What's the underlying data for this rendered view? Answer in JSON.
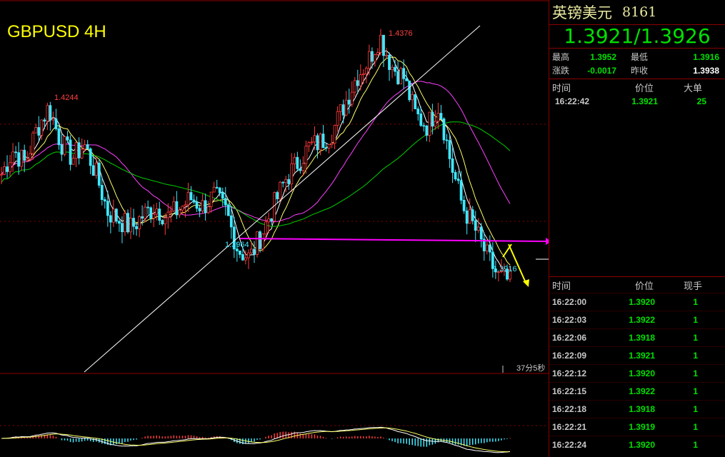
{
  "chart": {
    "symbol_label": "GBPUSD 4H",
    "countdown": "37分5秒",
    "annotations": {
      "high_left": "1.4244",
      "high_peak": "1.4376",
      "low_mid": "1.3964",
      "low_current": "1.3916"
    },
    "colors": {
      "bull": "#ff3b3b",
      "bear": "#40e8ff",
      "ma_short": "#ffffff",
      "ma_mid": "#ffff66",
      "ma_long": "#ff40ff",
      "ma_longest": "#00d000",
      "support": "#ff00ff",
      "trendline": "#ffffff",
      "arrow": "#ffff00"
    }
  },
  "chart_data": {
    "type": "line",
    "title": "GBPUSD 4H",
    "series": [
      {
        "values": [
          1.412,
          1.4165,
          1.414,
          1.4205,
          1.4244,
          1.418,
          1.415,
          1.4175,
          1.412,
          1.405,
          1.4035,
          1.402,
          1.4045,
          1.406,
          1.404,
          1.4055,
          1.4075,
          1.406,
          1.408,
          1.405,
          1.398,
          1.3964,
          1.401,
          1.406,
          1.411,
          1.414,
          1.417,
          1.418,
          1.42,
          1.425,
          1.43,
          1.433,
          1.4376,
          1.432,
          1.43,
          1.423,
          1.421,
          1.425,
          1.414,
          1.406,
          1.402,
          1.397,
          1.393,
          1.3921
        ]
      }
    ],
    "ylim": [
      1.39,
      1.439
    ]
  },
  "panel": {
    "name": "英镑美元",
    "code": "8161",
    "quote": "1.3921/1.3926",
    "stats": [
      {
        "l1": "最高",
        "v1": "1.3952",
        "l2": "最低",
        "v2": "1.3916"
      },
      {
        "l1": "涨跌",
        "v1": "-0.0017",
        "l2": "昨收",
        "v2": "1.3938"
      }
    ],
    "big_header": {
      "time": "时间",
      "price": "价位",
      "vol": "大单"
    },
    "big_rows": [
      {
        "time": "16:22:42",
        "price": "1.3921",
        "vol": "25"
      }
    ],
    "trade_header": {
      "time": "时间",
      "price": "价位",
      "vol": "现手"
    },
    "trades": [
      {
        "time": "16:22:00",
        "price": "1.3920",
        "vol": "1"
      },
      {
        "time": "16:22:03",
        "price": "1.3922",
        "vol": "1"
      },
      {
        "time": "16:22:06",
        "price": "1.3918",
        "vol": "1"
      },
      {
        "time": "16:22:09",
        "price": "1.3921",
        "vol": "1"
      },
      {
        "time": "16:22:12",
        "price": "1.3920",
        "vol": "1"
      },
      {
        "time": "16:22:15",
        "price": "1.3922",
        "vol": "1"
      },
      {
        "time": "16:22:18",
        "price": "1.3918",
        "vol": "1"
      },
      {
        "time": "16:22:21",
        "price": "1.3919",
        "vol": "1"
      },
      {
        "time": "16:22:24",
        "price": "1.3920",
        "vol": "1"
      }
    ]
  }
}
